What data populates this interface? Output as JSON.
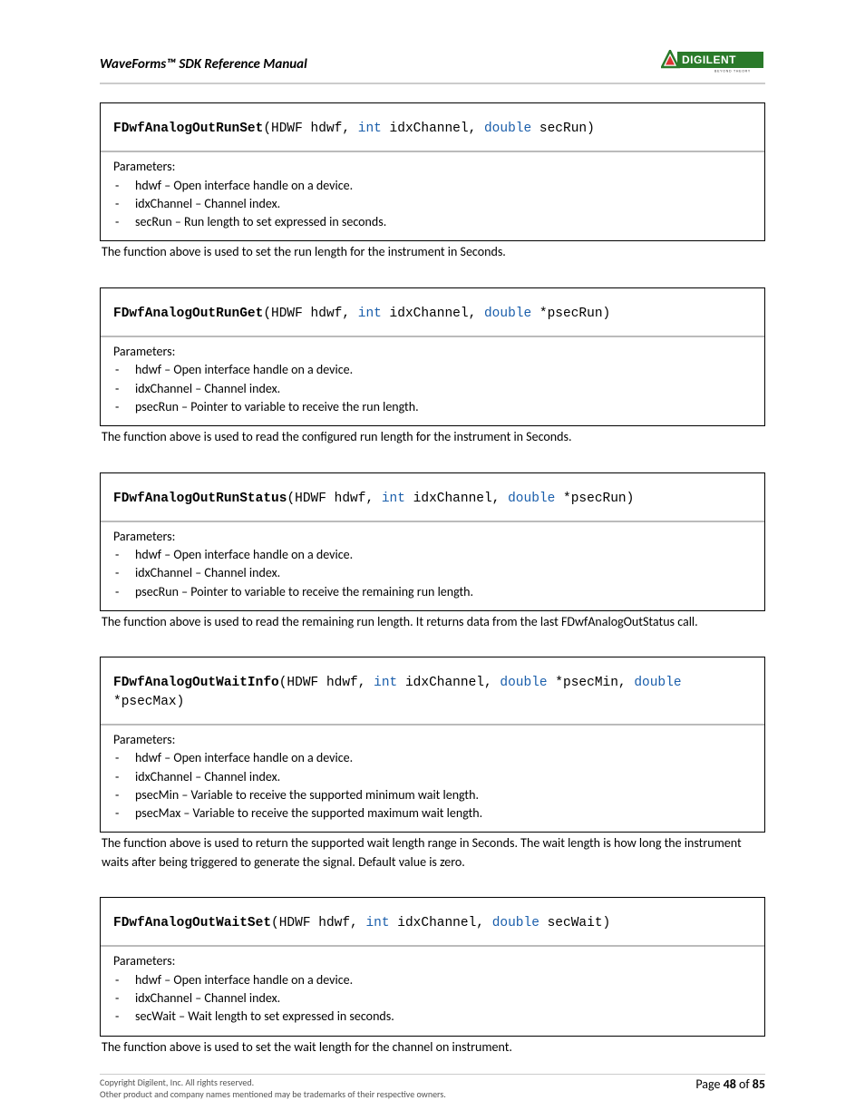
{
  "header": {
    "title": "WaveForms™ SDK Reference Manual"
  },
  "logo": {
    "brand": "DIGILENT",
    "tagline": "BEYOND THEORY"
  },
  "functions": [
    {
      "name": "FDwfAnalogOutRunSet",
      "sig_html": "<span class='fname'>FDwfAnalogOutRunSet</span>(HDWF hdwf, <span class='kw'>int</span> idxChannel, <span class='kw'>double</span> secRun)",
      "params": [
        "hdwf – Open interface handle on a device.",
        "idxChannel – Channel index.",
        "secRun – Run length to set expressed in seconds."
      ],
      "desc": "The function above is used to set the run length for the instrument in Seconds."
    },
    {
      "name": "FDwfAnalogOutRunGet",
      "sig_html": "<span class='fname'>FDwfAnalogOutRunGet</span>(HDWF hdwf, <span class='kw'>int</span> idxChannel, <span class='kw'>double</span> *psecRun)",
      "params": [
        "hdwf – Open interface handle on a device.",
        "idxChannel – Channel index.",
        "psecRun – Pointer to variable to receive the run length."
      ],
      "desc": "The function above is used to read the configured run length for the instrument in Seconds."
    },
    {
      "name": "FDwfAnalogOutRunStatus",
      "sig_html": "<span class='fname'>FDwfAnalogOutRunStatus</span>(HDWF hdwf, <span class='kw'>int</span> idxChannel, <span class='kw'>double</span> *psecRun)",
      "params": [
        "hdwf – Open interface handle on a device.",
        "idxChannel – Channel index.",
        "psecRun – Pointer to variable to receive the remaining run length."
      ],
      "desc": "The function above is used to read the remaining run length. It returns data from the last FDwfAnalogOutStatus call."
    },
    {
      "name": "FDwfAnalogOutWaitInfo",
      "sig_html": "<span class='fname'>FDwfAnalogOutWaitInfo</span>(HDWF hdwf, <span class='kw'>int</span> idxChannel, <span class='kw'>double</span> *psecMin, <span class='kw'>double</span> *psecMax)",
      "params": [
        "hdwf – Open interface handle on a device.",
        "idxChannel – Channel index.",
        "psecMin – Variable to receive the supported minimum wait length.",
        "psecMax – Variable to receive the supported maximum wait length."
      ],
      "desc": "The function above is used to return the supported wait length range in Seconds. The wait length is how long the instrument waits after being triggered to generate the signal. Default value is zero."
    },
    {
      "name": "FDwfAnalogOutWaitSet",
      "sig_html": "<span class='fname'>FDwfAnalogOutWaitSet</span>(HDWF hdwf, <span class='kw'>int</span> idxChannel, <span class='kw'>double</span> secWait)",
      "params": [
        "hdwf – Open interface handle on a device.",
        "idxChannel – Channel index.",
        "secWait – Wait length to set expressed in seconds."
      ],
      "desc": "The function above is used to set the wait length for the channel on instrument."
    }
  ],
  "footer": {
    "copyright": "Copyright Digilent, Inc. All rights reserved.",
    "trademark": "Other product and company names mentioned may be trademarks of their respective owners.",
    "page_label_prefix": "Page ",
    "page_current": "48",
    "page_sep": " of ",
    "page_total": "85"
  },
  "labels": {
    "parameters": "Parameters:"
  }
}
